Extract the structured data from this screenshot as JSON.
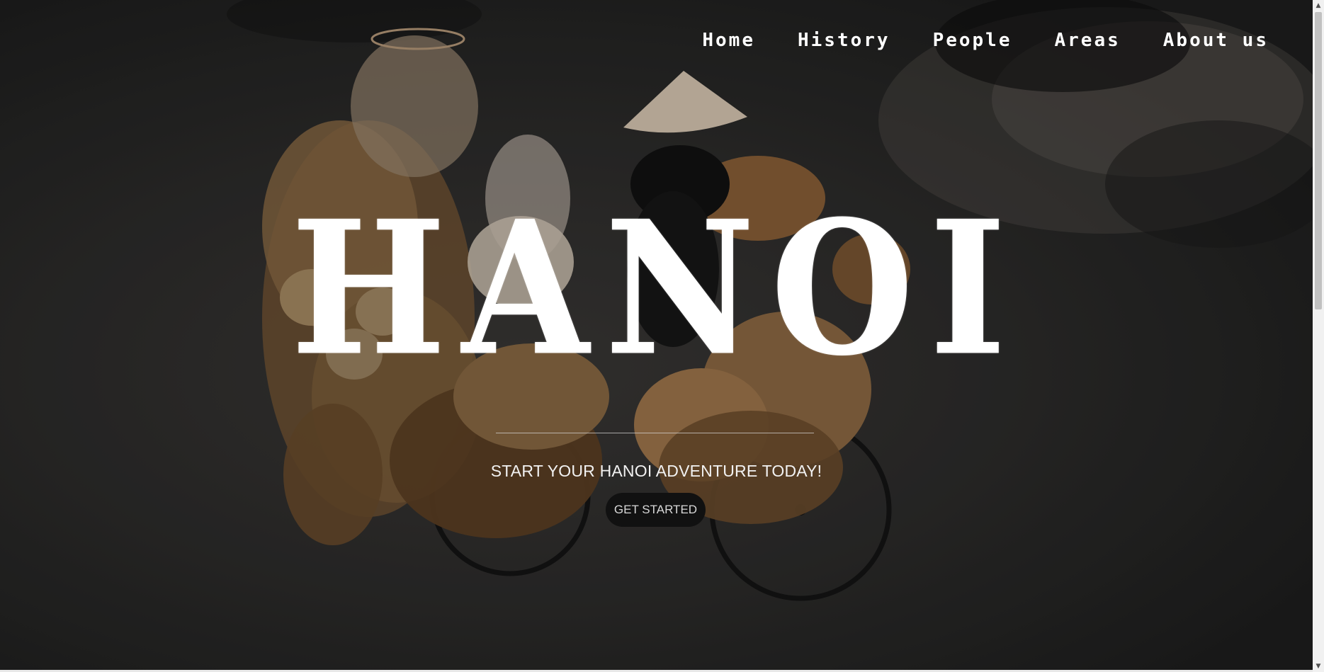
{
  "nav": {
    "items": [
      {
        "label": "Home"
      },
      {
        "label": "History"
      },
      {
        "label": "People"
      },
      {
        "label": "Areas"
      },
      {
        "label": "About us"
      }
    ]
  },
  "hero": {
    "title": "HANOI",
    "tagline": "START YOUR HANOI ADVENTURE TODAY!",
    "cta_label": "GET STARTED"
  },
  "scrollbar": {
    "up_glyph": "▲",
    "down_glyph": "▼"
  },
  "colors": {
    "title": "#ffffff",
    "cta_background": "#111111",
    "cta_text": "#d8d8d8"
  }
}
